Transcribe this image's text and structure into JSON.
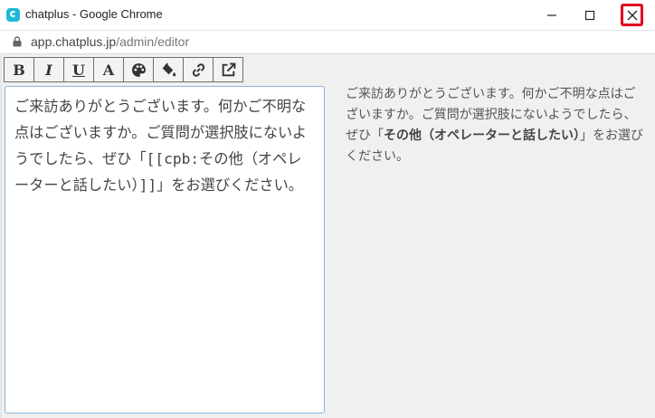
{
  "window": {
    "title": "chatplus - Google Chrome",
    "url_host": "app.chatplus.jp",
    "url_path": "/admin/editor"
  },
  "toolbar": {
    "bold_label": "B",
    "italic_label": "I",
    "underline_label": "U",
    "font_label": "A",
    "buttons": [
      "bold",
      "italic",
      "underline",
      "font-color",
      "palette-icon",
      "paint-bucket-icon",
      "link-icon",
      "external-link-icon"
    ]
  },
  "editor": {
    "value": "ご来訪ありがとうございます。何かご不明な点はございますか。ご質問が選択肢にないようでしたら、ぜひ「[[cpb:その他（オペレーターと話したい）]]」をお選びください。"
  },
  "preview": {
    "text_before": "ご来訪ありがとうございます。何かご不明な点はございますか。ご質問が選択肢にないようでしたら、ぜひ「",
    "bold_text": "その他（オペレーターと話したい）",
    "text_after": "」をお選びください。"
  },
  "colors": {
    "close_highlight": "#e0001b",
    "editor_border": "#8cb4e0",
    "app_icon": "#20b8d6"
  }
}
